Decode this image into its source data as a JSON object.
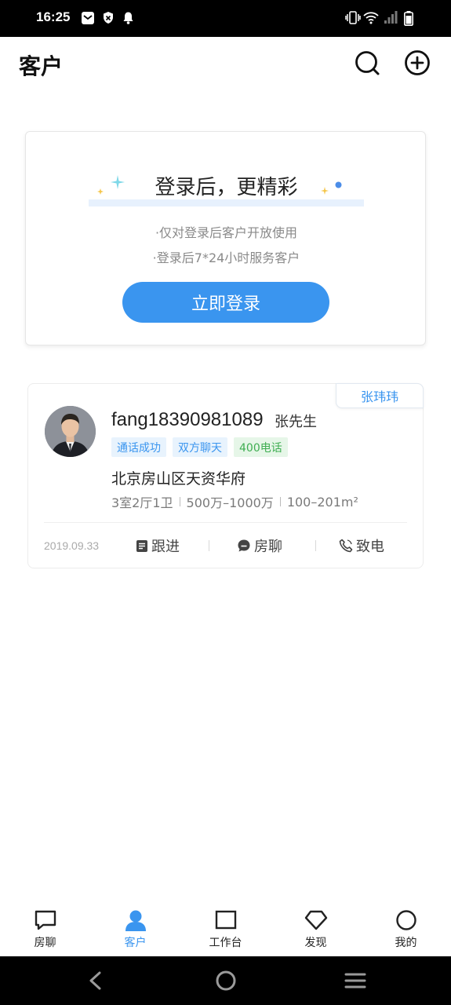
{
  "status_bar": {
    "time": "16:25"
  },
  "header": {
    "title": "客户",
    "search_icon": "search-icon",
    "add_icon": "add-circle-icon"
  },
  "login_card": {
    "title": "登录后，更精彩",
    "desc_1": "·仅对登录后客户开放使用",
    "desc_2": "·登录后7*24小时服务客户",
    "button_label": "立即登录"
  },
  "customer": {
    "agent_tag": "张玮玮",
    "name": "fang18390981089",
    "title": "张先生",
    "tags": [
      {
        "label": "通话成功",
        "style": "blue"
      },
      {
        "label": "双方聊天",
        "style": "blue"
      },
      {
        "label": "400电话",
        "style": "green"
      }
    ],
    "location": "北京房山区天资华府",
    "specs": [
      "3室2厅1卫",
      "500万–1000万",
      "100–201m²"
    ],
    "date": "2019.09.33",
    "actions": {
      "follow": "跟进",
      "chat": "房聊",
      "call": "致电"
    }
  },
  "tabs": [
    {
      "label": "房聊",
      "icon": "chat-icon",
      "active": false
    },
    {
      "label": "客户",
      "icon": "user-icon",
      "active": true
    },
    {
      "label": "工作台",
      "icon": "workbench-icon",
      "active": false
    },
    {
      "label": "发现",
      "icon": "diamond-icon",
      "active": false
    },
    {
      "label": "我的",
      "icon": "profile-icon",
      "active": false
    }
  ],
  "colors": {
    "accent": "#3a95ef",
    "green_tag": "#3fae52",
    "status_bar": "#000000"
  }
}
